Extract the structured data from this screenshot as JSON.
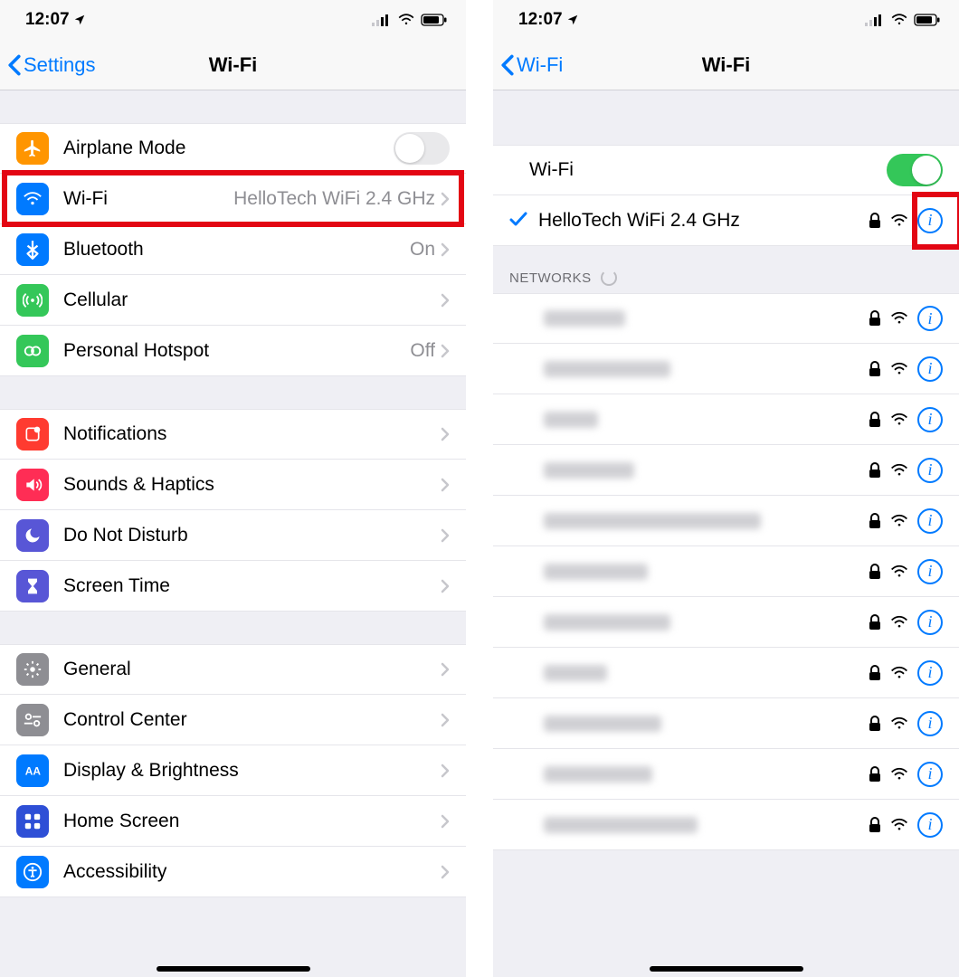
{
  "statusbar": {
    "time": "12:07"
  },
  "left": {
    "back": "Settings",
    "title": "Wi-Fi",
    "group1": [
      {
        "icon": "airplane",
        "label": "Airplane Mode",
        "toggle": "off"
      },
      {
        "icon": "wifi",
        "label": "Wi-Fi",
        "detail": "HelloTech WiFi 2.4 GHz",
        "highlight": true
      },
      {
        "icon": "bt",
        "label": "Bluetooth",
        "detail": "On"
      },
      {
        "icon": "cell",
        "label": "Cellular"
      },
      {
        "icon": "hotspot",
        "label": "Personal Hotspot",
        "detail": "Off"
      }
    ],
    "group2": [
      {
        "icon": "notif",
        "label": "Notifications"
      },
      {
        "icon": "sound",
        "label": "Sounds & Haptics"
      },
      {
        "icon": "dnd",
        "label": "Do Not Disturb"
      },
      {
        "icon": "screentime",
        "label": "Screen Time"
      }
    ],
    "group3": [
      {
        "icon": "general",
        "label": "General"
      },
      {
        "icon": "cc",
        "label": "Control Center"
      },
      {
        "icon": "display",
        "label": "Display & Brightness"
      },
      {
        "icon": "home",
        "label": "Home Screen"
      },
      {
        "icon": "access",
        "label": "Accessibility"
      }
    ]
  },
  "right": {
    "back": "Wi-Fi",
    "title": "Wi-Fi",
    "toggle_label": "Wi-Fi",
    "connected": "HelloTech WiFi 2.4 GHz",
    "section_header": "NETWORKS",
    "network_count": 11
  }
}
